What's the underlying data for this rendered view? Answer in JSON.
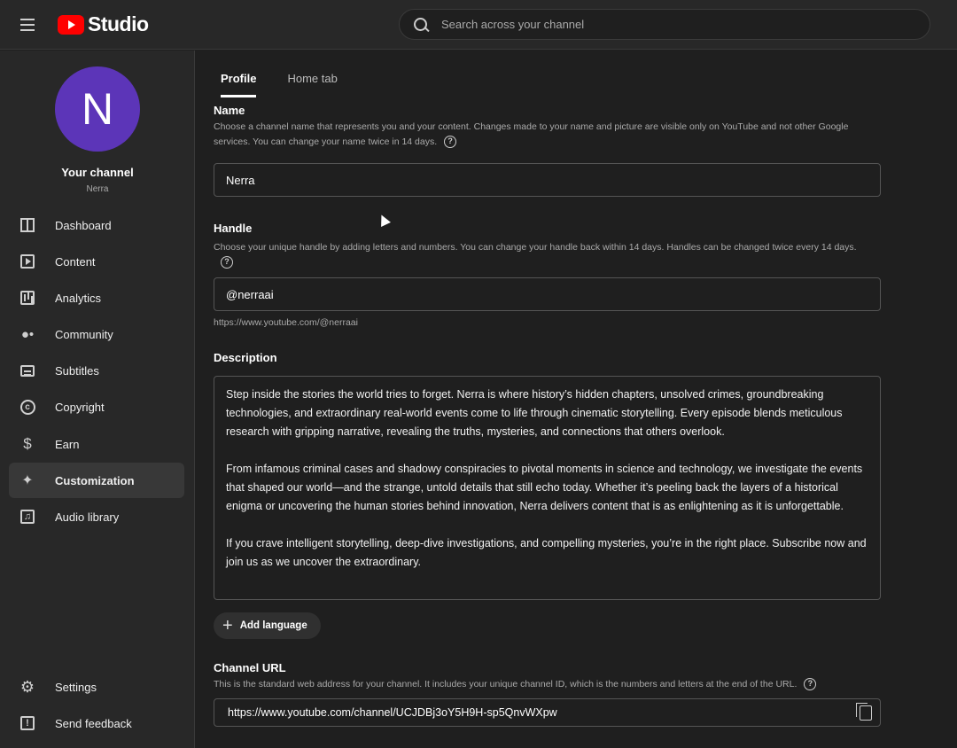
{
  "app": {
    "logo_text": "Studio",
    "brand_color": "#ff0000"
  },
  "search": {
    "placeholder": "Search across your channel"
  },
  "channel": {
    "avatar_letter": "N",
    "avatar_color": "#5c35b8",
    "title": "Your channel",
    "name": "Nerra"
  },
  "sidebar": {
    "items": [
      {
        "label": "Dashboard",
        "icon": "dashboard-icon"
      },
      {
        "label": "Content",
        "icon": "content-icon"
      },
      {
        "label": "Analytics",
        "icon": "analytics-icon"
      },
      {
        "label": "Community",
        "icon": "community-icon"
      },
      {
        "label": "Subtitles",
        "icon": "subtitles-icon"
      },
      {
        "label": "Copyright",
        "icon": "copyright-icon"
      },
      {
        "label": "Earn",
        "icon": "earn-icon"
      },
      {
        "label": "Customization",
        "icon": "customization-icon",
        "active": true
      },
      {
        "label": "Audio library",
        "icon": "audio-library-icon"
      }
    ],
    "bottom": [
      {
        "label": "Settings",
        "icon": "settings-icon"
      },
      {
        "label": "Send feedback",
        "icon": "feedback-icon"
      }
    ]
  },
  "tabs": [
    {
      "label": "Profile",
      "active": true
    },
    {
      "label": "Home tab"
    }
  ],
  "name_section": {
    "title": "Name",
    "description": "Choose a channel name that represents you and your content. Changes made to your name and picture are visible only on YouTube and not other Google services. You can change your name twice in 14 days.",
    "value": "Nerra"
  },
  "handle_section": {
    "title": "Handle",
    "description": "Choose your unique handle by adding letters and numbers. You can change your handle back within 14 days. Handles can be changed twice every 14 days.",
    "value": "@nerraai",
    "url": "https://www.youtube.com/@nerraai"
  },
  "description_section": {
    "title": "Description",
    "paragraphs": [
      "Step inside the stories the world tries to forget. Nerra is where history’s hidden chapters, unsolved crimes, groundbreaking technologies, and extraordinary real-world events come to life through cinematic storytelling. Every episode blends meticulous research with gripping narrative, revealing the truths, mysteries, and connections that others overlook.",
      "From infamous criminal cases and shadowy conspiracies to pivotal moments in science and technology, we investigate the events that shaped our world—and the strange, untold details that still echo today. Whether it’s peeling back the layers of a historical enigma or uncovering the human stories behind innovation, Nerra delivers content that is as enlightening as it is unforgettable.",
      "If you crave intelligent storytelling, deep-dive investigations, and compelling mysteries, you’re in the right place. Subscribe now and join us as we uncover the extraordinary."
    ],
    "add_language_label": "Add language"
  },
  "channel_url_section": {
    "title": "Channel URL",
    "description": "This is the standard web address for your channel. It includes your unique channel ID, which is the numbers and letters at the end of the URL.",
    "value": "https://www.youtube.com/channel/UCJDBj3oY5H9H-sp5QnvWXpw"
  }
}
